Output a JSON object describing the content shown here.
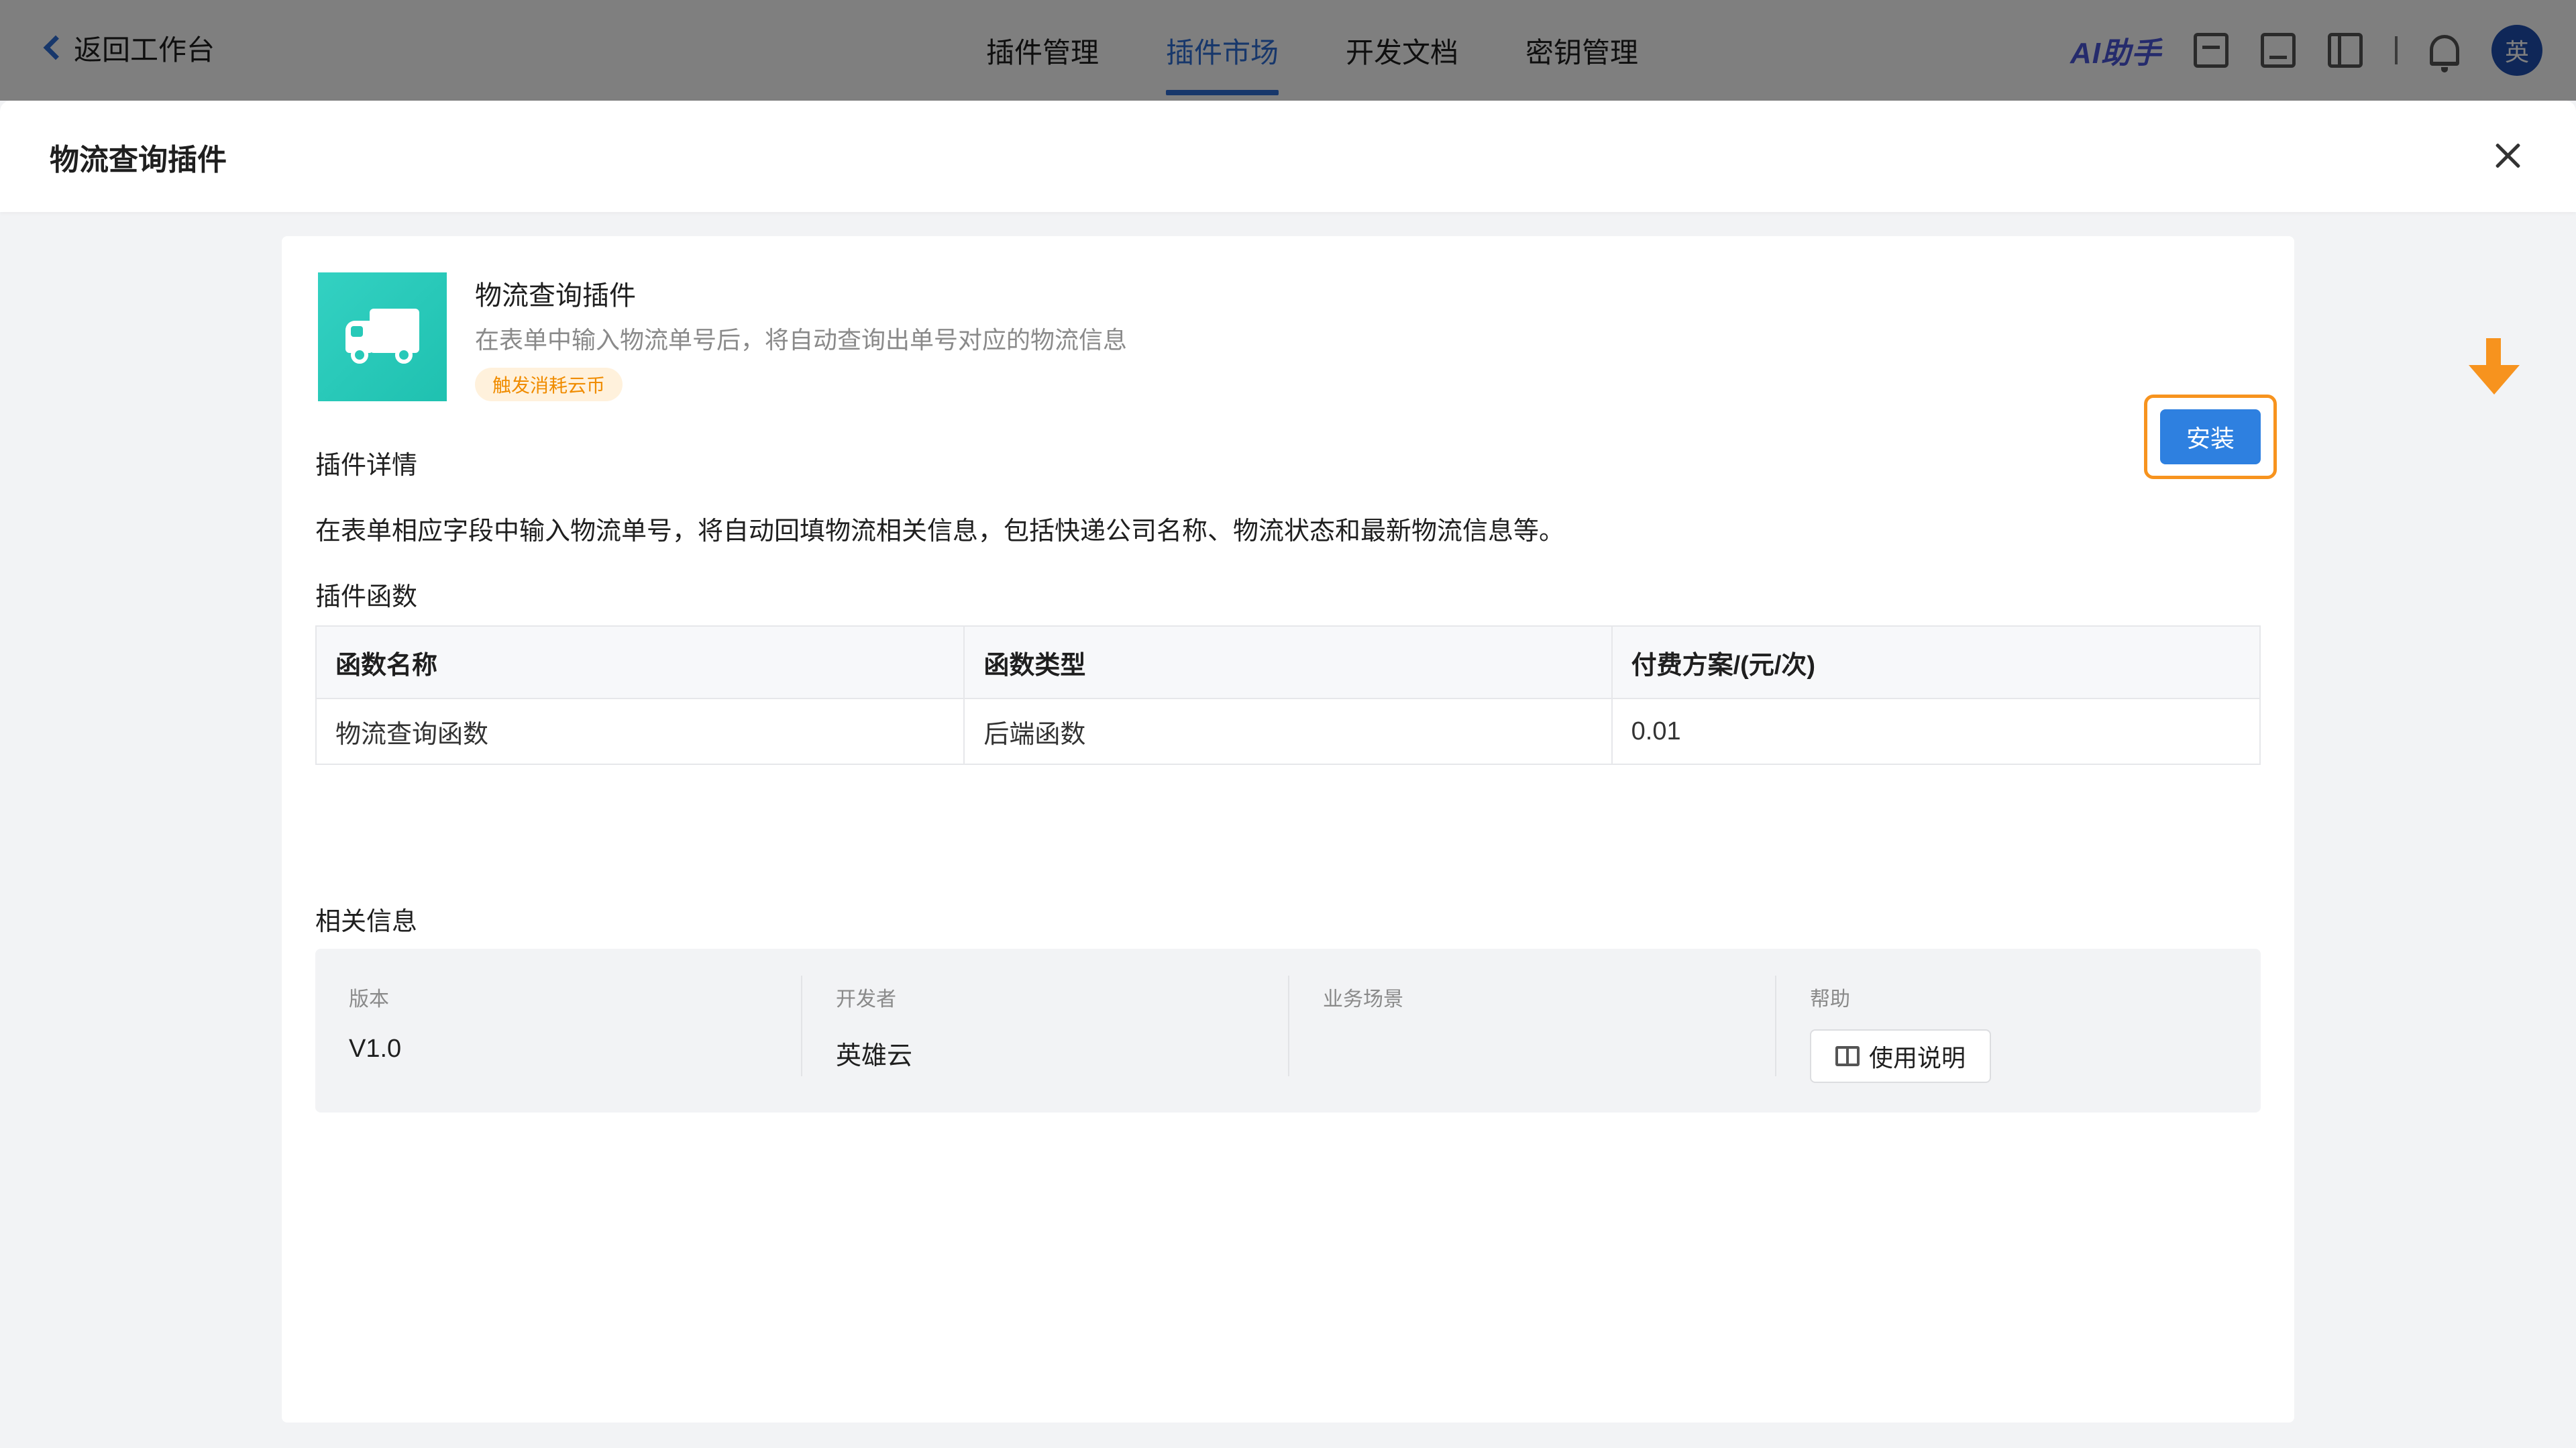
{
  "topbar": {
    "back_label": "返回工作台",
    "nav": [
      {
        "label": "插件管理",
        "active": false
      },
      {
        "label": "插件市场",
        "active": true
      },
      {
        "label": "开发文档",
        "active": false
      },
      {
        "label": "密钥管理",
        "active": false
      }
    ],
    "ai_label": "AI助手",
    "avatar_text": "英"
  },
  "drawer": {
    "title": "物流查询插件",
    "plugin": {
      "name": "物流查询插件",
      "description": "在表单中输入物流单号后，将自动查询出单号对应的物流信息",
      "tag": "触发消耗云币",
      "install_label": "安装",
      "logo_icon": "truck-icon"
    },
    "details_title": "插件详情",
    "details_text": "在表单相应字段中输入物流单号，将自动回填物流相关信息，包括快递公司名称、物流状态和最新物流信息等。",
    "functions_title": "插件函数",
    "functions_table": {
      "headers": [
        "函数名称",
        "函数类型",
        "付费方案/(元/次)"
      ],
      "rows": [
        [
          "物流查询函数",
          "后端函数",
          "0.01"
        ]
      ]
    },
    "related_title": "相关信息",
    "related": {
      "version_label": "版本",
      "version_value": "V1.0",
      "developer_label": "开发者",
      "developer_value": "英雄云",
      "scene_label": "业务场景",
      "help_label": "帮助",
      "help_button": "使用说明"
    }
  },
  "colors": {
    "accent": "#2e6fd6",
    "install": "#2e80e0",
    "highlight": "#f7931e",
    "logo": "#27c9b8"
  }
}
